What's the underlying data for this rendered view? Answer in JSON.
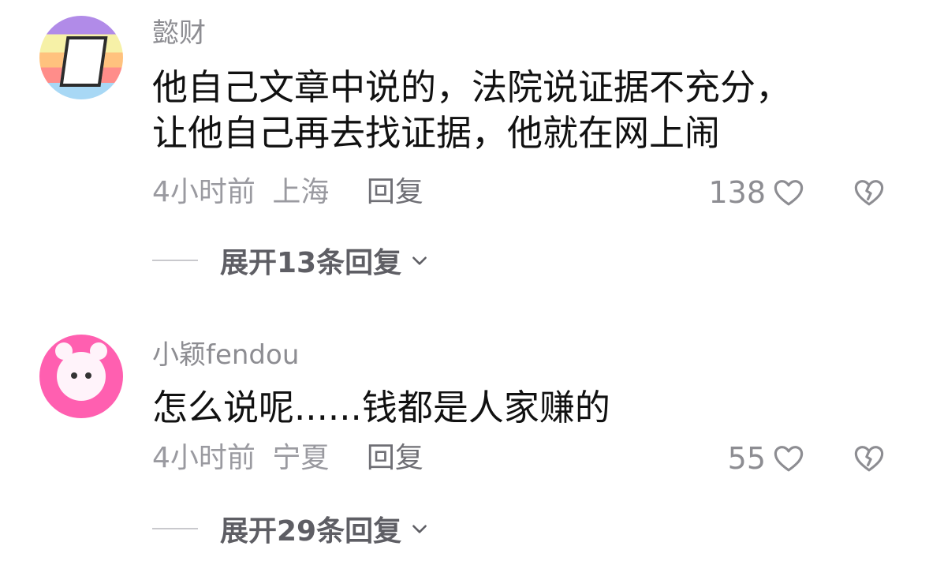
{
  "comments": [
    {
      "username": "懿财",
      "text_lines": [
        "他自己文章中说的，法院说证据不充分，",
        "让他自己再去找证据，他就在网上闹"
      ],
      "time": "4小时前",
      "location": "上海",
      "reply_label": "回复",
      "likes": "138",
      "expand_label": "展开13条回复",
      "avatar_icon": "rainbow-stripe-avatar",
      "like_icon": "heart-icon",
      "dislike_icon": "broken-heart-icon"
    },
    {
      "username": "小颖fendou",
      "text_lines": [
        "怎么说呢......钱都是人家赚的"
      ],
      "time": "4小时前",
      "location": "宁夏",
      "reply_label": "回复",
      "likes": "55",
      "expand_label": "展开29条回复",
      "avatar_icon": "pink-plush-avatar",
      "like_icon": "heart-icon",
      "dislike_icon": "broken-heart-icon"
    }
  ]
}
